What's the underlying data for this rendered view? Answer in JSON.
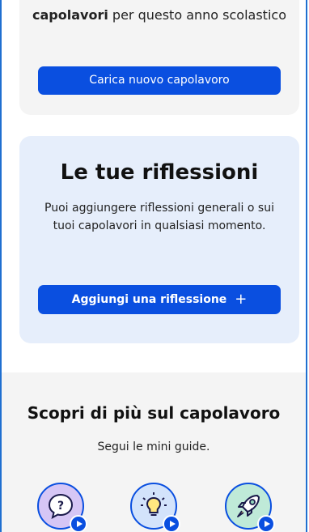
{
  "upload_card": {
    "text_bold": "capolavori",
    "text_rest": " per questo anno scolastico",
    "button_label": "Carica nuovo capolavoro"
  },
  "reflections_card": {
    "title": "Le tue riflessioni",
    "description": "Puoi aggiungere riflessioni generali o sui tuoi capolavori in qualsiasi momento.",
    "button_label": "Aggiungi una riflessione",
    "button_icon": "plus-icon"
  },
  "discover": {
    "title": "Scopri di più sul capolavoro",
    "subtitle": "Segui le mini guide.",
    "guides": [
      {
        "icon": "question-bubble-icon",
        "color": "#d6c6f5"
      },
      {
        "icon": "lightbulb-icon",
        "color": "#d3e3fb"
      },
      {
        "icon": "rocket-icon",
        "color": "#bfead8"
      }
    ]
  },
  "colors": {
    "accent": "#0a4fe0",
    "frame": "#1f6fd0",
    "reflections_bg": "#e6eefb",
    "card_bg": "#f4f4f4"
  }
}
